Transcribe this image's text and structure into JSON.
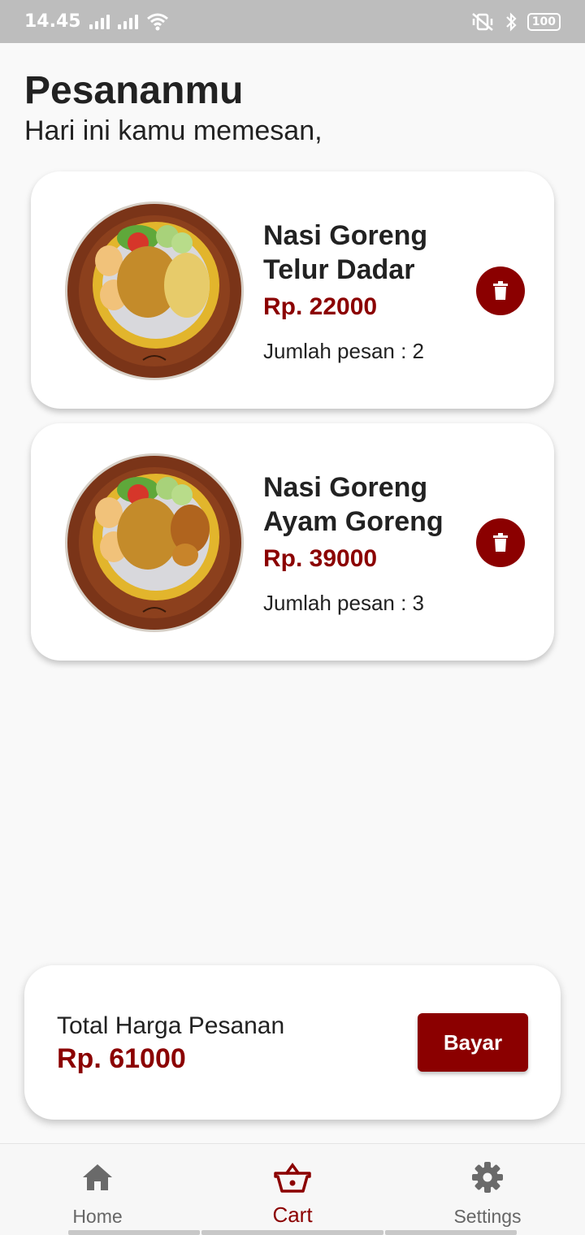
{
  "status_bar": {
    "time": "14.45",
    "battery": "100"
  },
  "header": {
    "title": "Pesananmu",
    "subtitle": "Hari ini kamu memesan,"
  },
  "orders": [
    {
      "name": "Nasi Goreng Telur Dadar",
      "price": "Rp. 22000",
      "quantity": "Jumlah pesan : 2"
    },
    {
      "name": "Nasi Goreng Ayam Goreng",
      "price": "Rp. 39000",
      "quantity": "Jumlah pesan : 3"
    }
  ],
  "total": {
    "label": "Total Harga Pesanan",
    "value": "Rp. 61000",
    "pay_label": "Bayar"
  },
  "nav": {
    "home": "Home",
    "cart": "Cart",
    "settings": "Settings"
  },
  "colors": {
    "accent": "#8b0000",
    "background": "#f9f9f9",
    "status_bar": "#bdbdbd"
  },
  "icons": [
    "signal-icon",
    "wifi-icon",
    "vibrate-off-icon",
    "bluetooth-icon",
    "battery-icon",
    "trash-icon",
    "home-icon",
    "cart-basket-icon",
    "gear-icon"
  ]
}
